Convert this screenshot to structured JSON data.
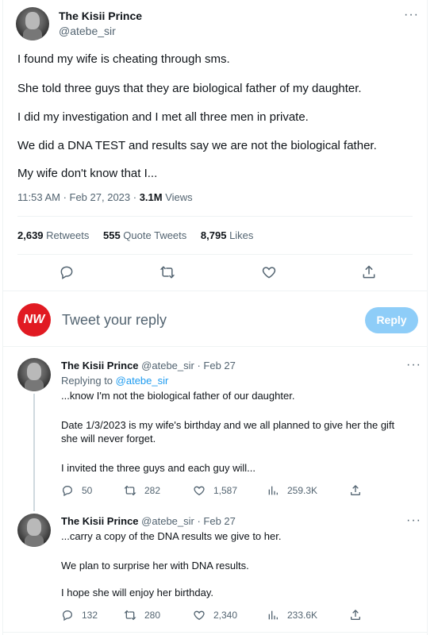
{
  "main_tweet": {
    "author_name": "The Kisii Prince",
    "handle": "@atebe_sir",
    "lines": [
      "I found my wife is cheating through sms.",
      "She told three guys that they are biological father of my daughter.",
      "I did my investigation and I met all three men in private.",
      "We did a DNA TEST and results say we are not the biological father.",
      "My wife don't know that I..."
    ],
    "time": "11:53 AM · Feb 27, 2023 · ",
    "views_count": "3.1M",
    "views_label": " Views",
    "retweets_count": "2,639",
    "retweets_label": " Retweets",
    "quotes_count": "555",
    "quotes_label": " Quote Tweets",
    "likes_count": "8,795",
    "likes_label": " Likes"
  },
  "composer": {
    "avatar_text": "NW",
    "placeholder": "Tweet your reply",
    "reply_button": "Reply"
  },
  "replies": [
    {
      "author_name": "The Kisii Prince",
      "handle": "@atebe_sir · Feb 27",
      "replying_prefix": "Replying to ",
      "replying_handle": "@atebe_sir",
      "lines": [
        "...know I'm not the biological father of our daughter.",
        "Date 1/3/2023 is my wife's birthday and we all planned to give her the gift",
        "she will never forget.",
        "I invited the three guys and each guy will..."
      ],
      "replies": "50",
      "retweets": "282",
      "likes": "1,587",
      "views": "259.3K"
    },
    {
      "author_name": "The Kisii Prince",
      "handle": "@atebe_sir · Feb 27",
      "lines": [
        "...carry a copy of the DNA results we give to her.",
        "We plan to surprise her with DNA results.",
        "I hope she will enjoy her birthday."
      ],
      "replies": "132",
      "retweets": "280",
      "likes": "2,340",
      "views": "233.6K"
    }
  ],
  "icons": {
    "more": "more-icon",
    "reply": "reply-icon",
    "retweet": "retweet-icon",
    "like": "heart-icon",
    "share": "share-icon",
    "views": "views-icon"
  },
  "colors": {
    "accent": "#1d9bf0",
    "reply_button": "#8ecdf8",
    "nw_red": "#e11a22",
    "muted": "#536471"
  }
}
